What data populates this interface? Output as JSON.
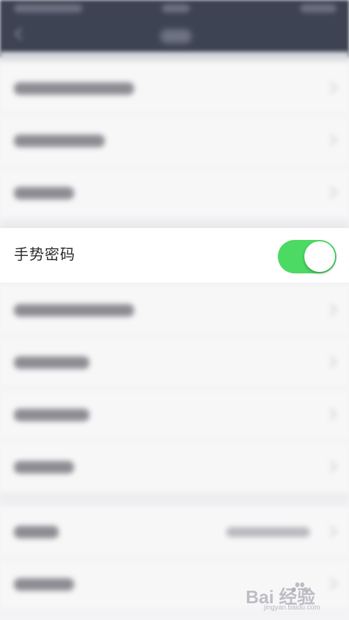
{
  "settings_row": {
    "label": "手势密码",
    "toggle_on": true,
    "toggle_color": "#4cd964"
  },
  "watermark": {
    "brand": "Bai 经验",
    "url": "jingyan.baidu.com"
  },
  "theme": {
    "topbar_color": "#3e4353",
    "background": "#f4f4f6"
  }
}
